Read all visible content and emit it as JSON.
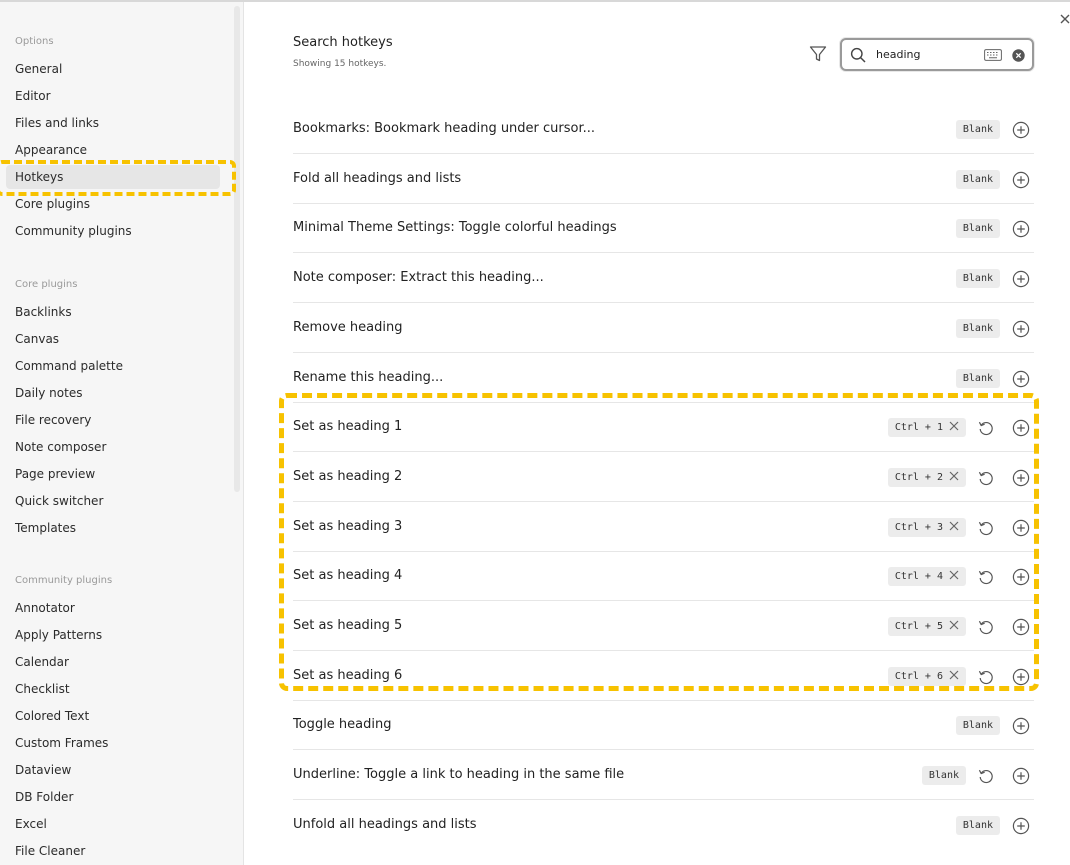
{
  "sidebar": {
    "sections": [
      {
        "title": "Options",
        "items": [
          "General",
          "Editor",
          "Files and links",
          "Appearance",
          "Hotkeys",
          "Core plugins",
          "Community plugins"
        ]
      },
      {
        "title": "Core plugins",
        "items": [
          "Backlinks",
          "Canvas",
          "Command palette",
          "Daily notes",
          "File recovery",
          "Note composer",
          "Page preview",
          "Quick switcher",
          "Templates"
        ]
      },
      {
        "title": "Community plugins",
        "items": [
          "Annotator",
          "Apply Patterns",
          "Calendar",
          "Checklist",
          "Colored Text",
          "Custom Frames",
          "Dataview",
          "DB Folder",
          "Excel",
          "File Cleaner"
        ]
      }
    ],
    "active_item": "Hotkeys"
  },
  "header": {
    "title": "Search hotkeys",
    "subtitle": "Showing 15 hotkeys.",
    "search_value": "heading"
  },
  "hotkey_rows": [
    {
      "label": "Bookmarks: Bookmark heading under cursor...",
      "hotkey": "Blank",
      "removable": false,
      "restore": false
    },
    {
      "label": "Fold all headings and lists",
      "hotkey": "Blank",
      "removable": false,
      "restore": false
    },
    {
      "label": "Minimal Theme Settings: Toggle colorful headings",
      "hotkey": "Blank",
      "removable": false,
      "restore": false
    },
    {
      "label": "Note composer: Extract this heading...",
      "hotkey": "Blank",
      "removable": false,
      "restore": false
    },
    {
      "label": "Remove heading",
      "hotkey": "Blank",
      "removable": false,
      "restore": false
    },
    {
      "label": "Rename this heading...",
      "hotkey": "Blank",
      "removable": false,
      "restore": false
    },
    {
      "label": "Set as heading 1",
      "hotkey": "Ctrl + 1",
      "removable": true,
      "restore": true
    },
    {
      "label": "Set as heading 2",
      "hotkey": "Ctrl + 2",
      "removable": true,
      "restore": true
    },
    {
      "label": "Set as heading 3",
      "hotkey": "Ctrl + 3",
      "removable": true,
      "restore": true
    },
    {
      "label": "Set as heading 4",
      "hotkey": "Ctrl + 4",
      "removable": true,
      "restore": true
    },
    {
      "label": "Set as heading 5",
      "hotkey": "Ctrl + 5",
      "removable": true,
      "restore": true
    },
    {
      "label": "Set as heading 6",
      "hotkey": "Ctrl + 6",
      "removable": true,
      "restore": true
    },
    {
      "label": "Toggle heading",
      "hotkey": "Blank",
      "removable": false,
      "restore": false
    },
    {
      "label": "Underline: Toggle a link to heading in the same file",
      "hotkey": "Blank",
      "removable": false,
      "restore": true
    },
    {
      "label": "Unfold all headings and lists",
      "hotkey": "Blank",
      "removable": false,
      "restore": false
    }
  ],
  "colors": {
    "highlight": "#f7c200",
    "sidebar_bg": "#f6f6f6",
    "hotkey_bg": "#ececec"
  },
  "icons": [
    "close-icon",
    "filter-icon",
    "search-icon",
    "keyboard-icon",
    "clear-icon",
    "restore-icon",
    "add-circle-icon",
    "remove-x-icon"
  ]
}
